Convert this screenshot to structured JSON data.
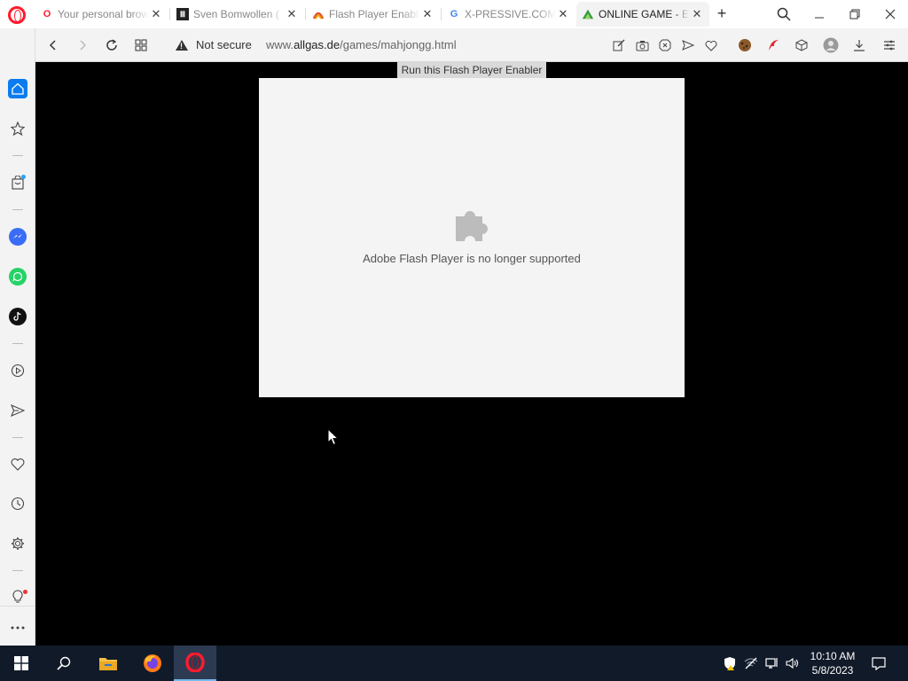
{
  "tabs": [
    {
      "title": "Your personal brow",
      "favicon": "opera-icon"
    },
    {
      "title": "Sven Bomwollen (",
      "favicon": "museum-icon"
    },
    {
      "title": "Flash Player Enabl",
      "favicon": "flash-icon"
    },
    {
      "title": "X-PRESSIVE.COM",
      "favicon": "google-icon"
    },
    {
      "title": "ONLINE GAME - E",
      "favicon": "game-icon",
      "active": true
    }
  ],
  "address": {
    "security_label": "Not secure",
    "url_prefix": "www.",
    "url_host": "allgas.de",
    "url_path": "/games/mahjongg.html"
  },
  "page": {
    "enabler_label": "Run this Flash Player Enabler",
    "plugin_message": "Adobe Flash Player is no longer supported"
  },
  "clock": {
    "time": "10:10 AM",
    "date": "5/8/2023"
  },
  "colors": {
    "opera_red": "#ff1b2d",
    "sidebar_home": "#0a7cf0",
    "taskbar": "#111a29"
  }
}
